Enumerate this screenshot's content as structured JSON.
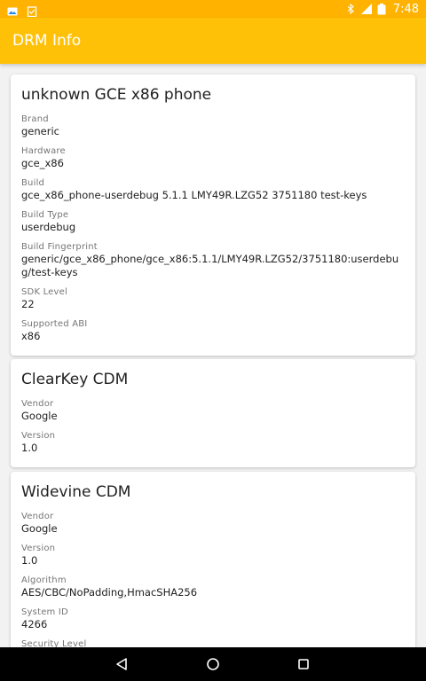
{
  "status_bar": {
    "time": "7:48",
    "icons_left": [
      "photo-notification-icon",
      "clipboard-check-icon"
    ],
    "icons_right": [
      "bluetooth-icon",
      "signal-lte-icon",
      "battery-icon"
    ]
  },
  "app_bar": {
    "title": "DRM Info"
  },
  "cards": {
    "device": {
      "title": "unknown GCE x86 phone",
      "fields": [
        {
          "label": "Brand",
          "value": "generic"
        },
        {
          "label": "Hardware",
          "value": "gce_x86"
        },
        {
          "label": "Build",
          "value": "gce_x86_phone-userdebug 5.1.1 LMY49R.LZG52 3751180 test-keys"
        },
        {
          "label": "Build Type",
          "value": "userdebug"
        },
        {
          "label": "Build Fingerprint",
          "value": "generic/gce_x86_phone/gce_x86:5.1.1/LMY49R.LZG52/3751180:userdebug/test-keys"
        },
        {
          "label": "SDK Level",
          "value": "22"
        },
        {
          "label": "Supported ABI",
          "value": "x86"
        }
      ]
    },
    "clearkey": {
      "title": "ClearKey CDM",
      "fields": [
        {
          "label": "Vendor",
          "value": "Google"
        },
        {
          "label": "Version",
          "value": "1.0"
        }
      ]
    },
    "widevine": {
      "title": "Widevine CDM",
      "fields": [
        {
          "label": "Vendor",
          "value": "Google"
        },
        {
          "label": "Version",
          "value": "1.0"
        },
        {
          "label": "Algorithm",
          "value": "AES/CBC/NoPadding,HmacSHA256"
        },
        {
          "label": "System ID",
          "value": "4266"
        },
        {
          "label": "Security Level",
          "value": ""
        }
      ]
    }
  },
  "nav_bar": {
    "buttons": [
      "back-button",
      "home-button",
      "recents-button"
    ]
  },
  "colors": {
    "primary": "#FFC107",
    "primary_dark": "#FFB300"
  }
}
